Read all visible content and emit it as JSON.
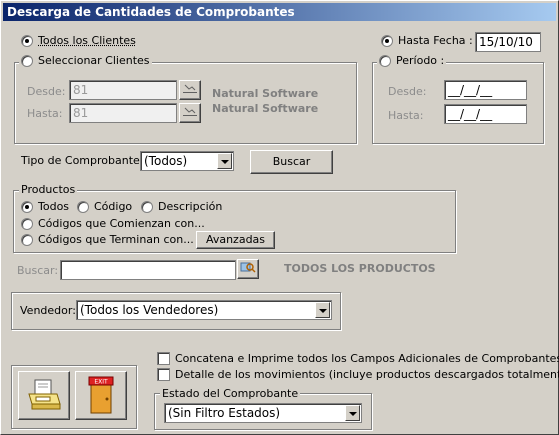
{
  "window": {
    "title": "Descarga de Cantidades de Comprobantes"
  },
  "clients": {
    "all_label": "Todos los Clientes",
    "select_label": "Seleccionar Clientes",
    "from_label": "Desde:",
    "from_value": "81",
    "to_label": "Hasta:",
    "to_value": "81",
    "brand_line1": "Natural Software",
    "brand_line2": "Natural Software"
  },
  "dates": {
    "until_label": "Hasta Fecha :",
    "until_value": "15/10/10",
    "period_label": "Período :",
    "from_label": "Desde:",
    "from_value": "__/__/__",
    "to_label": "Hasta:",
    "to_value": "__/__/__"
  },
  "voucher": {
    "label": "Tipo de Comprobante",
    "selected": "(Todos)",
    "search_button": "Buscar"
  },
  "products": {
    "legend": "Productos",
    "opt_all": "Todos",
    "opt_code": "Código",
    "opt_desc": "Descripción",
    "opt_begins": "Códigos que Comienzan con...",
    "opt_ends": "Códigos que Terminan con...",
    "advanced_button": "Avanzadas"
  },
  "search": {
    "label": "Buscar:",
    "value": "",
    "status": "TODOS LOS PRODUCTOS"
  },
  "seller": {
    "label": "Vendedor:",
    "selected": "(Todos los Vendedores)"
  },
  "options": {
    "concat_label": "Concatena e Imprime todos los Campos Adicionales de Comprobantes",
    "detail_label": "Detalle de los movimientos (incluye productos descargados totalmente)"
  },
  "state": {
    "legend": "Estado del Comprobante",
    "selected": "(Sin Filtro Estados)"
  },
  "actions": {
    "exit_text": "EXIT"
  }
}
